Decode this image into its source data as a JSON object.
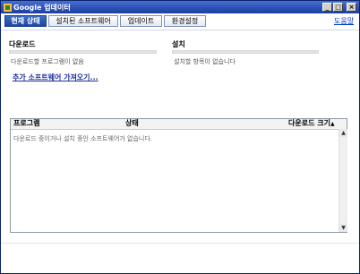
{
  "window": {
    "title": "Google 업데이터"
  },
  "tabs": [
    {
      "label": "현재 상태",
      "active": true
    },
    {
      "label": "설치된 소프트웨어",
      "active": false
    },
    {
      "label": "업데이트",
      "active": false
    },
    {
      "label": "환경설정",
      "active": false
    }
  ],
  "help_label": "도움말",
  "download": {
    "heading": "다운로드",
    "message": "다운로드할 프로그램이 없음"
  },
  "install": {
    "heading": "설치",
    "message": "설치할 항목이 없습니다"
  },
  "add_software_link": "추가 소프트웨어 가져오기...",
  "list": {
    "columns": [
      "프로그램",
      "상태",
      "다운로드 크기"
    ],
    "sort_indicator": "▲",
    "empty_message": "다운로드 중이거나 설치 중인 소프트웨어가 없습니다."
  },
  "colors": {
    "active_tab": "#2a55b0",
    "link": "#1d2f9a",
    "titlebar": "#2a4fb6"
  }
}
